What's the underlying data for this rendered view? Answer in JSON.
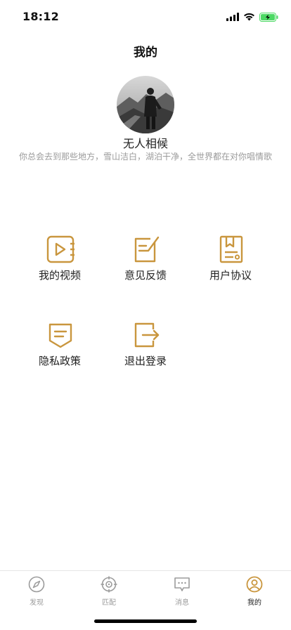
{
  "status_bar": {
    "time": "18:12"
  },
  "header": {
    "title": "我的"
  },
  "profile": {
    "name": "无人相候",
    "bio": "你总会去到那些地方，雪山洁白，湖泊干净，全世界都在对你唱情歌"
  },
  "menu": [
    {
      "label": "我的视频",
      "icon": "video-icon"
    },
    {
      "label": "意见反馈",
      "icon": "feedback-icon"
    },
    {
      "label": "用户协议",
      "icon": "agreement-icon"
    },
    {
      "label": "隐私政策",
      "icon": "privacy-icon"
    },
    {
      "label": "退出登录",
      "icon": "logout-icon"
    }
  ],
  "tabbar": {
    "items": [
      {
        "label": "发现",
        "icon": "compass-icon"
      },
      {
        "label": "匹配",
        "icon": "target-icon"
      },
      {
        "label": "消息",
        "icon": "message-icon"
      },
      {
        "label": "我的",
        "icon": "user-icon"
      }
    ],
    "active_index": 3
  },
  "colors": {
    "accent": "#C9963E",
    "inactive": "#9B9B9B",
    "text": "#222222",
    "battery": "#4CD964"
  }
}
